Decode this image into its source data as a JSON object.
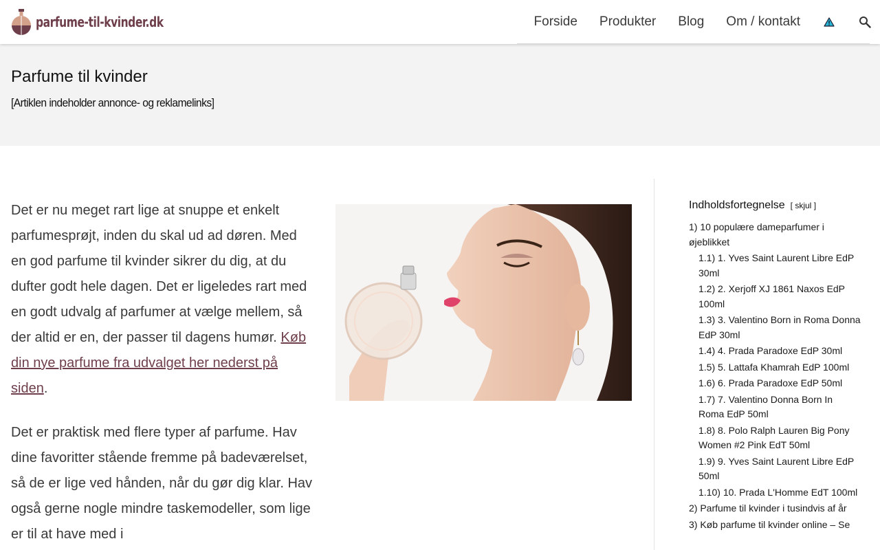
{
  "header": {
    "logo_text": "parfume-til-kvinder.dk",
    "nav": [
      "Forside",
      "Produkter",
      "Blog",
      "Om / kontakt"
    ],
    "accent_color": "#6e3f4b",
    "icons": [
      "warning-triangle-icon",
      "search-icon"
    ]
  },
  "banner": {
    "title": "Parfume til kvinder",
    "disclaimer": "[Artiklen indeholder annonce- og reklamelinks]"
  },
  "article": {
    "p1_text": "Det er nu meget rart lige at snuppe et enkelt parfumesprøjt, inden du skal ud ad døren. Med en god parfume til kvinder sikrer du dig, at du dufter godt hele dagen. Det er ligeledes rart med en godt udvalg af parfumer at vælge mellem, så der altid er en, der passer til dagens humør. ",
    "p1_link": "Køb din nye parfume fra udvalget her nederst på siden",
    "p1_end": ".",
    "p2_text": "Det er praktisk med flere typer af parfume. Hav dine favoritter stående fremme på badeværelset, så de er lige ved hånden, når du gør dig klar. Hav også gerne nogle mindre taskemodeller, som lige er til at have med i"
  },
  "toc": {
    "title": "Indholdsfortegnelse",
    "toggle_open": "[",
    "toggle_label": "skjul",
    "toggle_close": "]",
    "items": [
      {
        "num": "1)",
        "text": "10 populære dameparfumer i øjeblikket",
        "level": 1
      },
      {
        "num": "1.1)",
        "text": "1. Yves Saint Laurent Libre EdP 30ml",
        "level": 2
      },
      {
        "num": "1.2)",
        "text": "2. Xerjoff XJ 1861 Naxos EdP 100ml",
        "level": 2
      },
      {
        "num": "1.3)",
        "text": "3. Valentino Born in Roma Donna EdP 30ml",
        "level": 2
      },
      {
        "num": "1.4)",
        "text": "4. Prada Paradoxe EdP 30ml",
        "level": 2
      },
      {
        "num": "1.5)",
        "text": "5. Lattafa Khamrah EdP 100ml",
        "level": 2
      },
      {
        "num": "1.6)",
        "text": "6. Prada Paradoxe EdP 50ml",
        "level": 2
      },
      {
        "num": "1.7)",
        "text": "7. Valentino Donna Born In Roma EdP 50ml",
        "level": 2
      },
      {
        "num": "1.8)",
        "text": "8. Polo Ralph Lauren Big Pony Women #2 Pink EdT 50ml",
        "level": 2
      },
      {
        "num": "1.9)",
        "text": "9. Yves Saint Laurent Libre EdP 50ml",
        "level": 2
      },
      {
        "num": "1.10)",
        "text": "10. Prada L'Homme EdT 100ml",
        "level": 2
      },
      {
        "num": "2)",
        "text": "Parfume til kvinder i tusindvis af år",
        "level": 1
      },
      {
        "num": "3)",
        "text": "Køb parfume til kvinder online – Se",
        "level": 1
      }
    ]
  }
}
